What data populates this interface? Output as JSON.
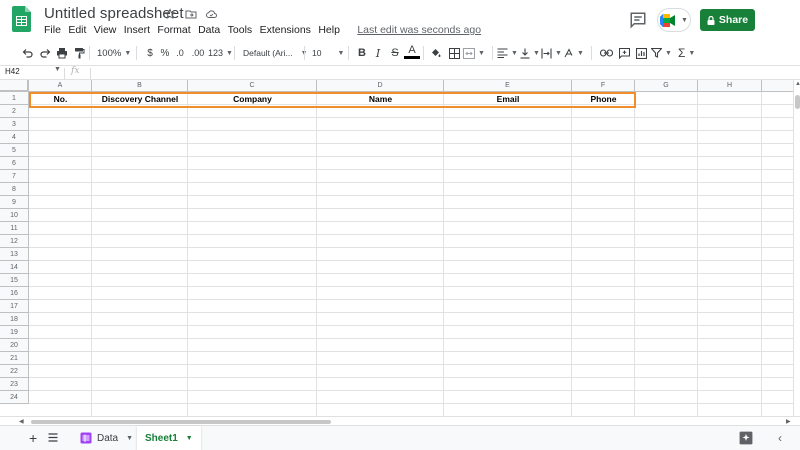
{
  "app": {
    "doc_title": "Untitled spreadsheet",
    "last_edit": "Last edit was seconds ago",
    "share_label": "Share"
  },
  "menu": [
    "File",
    "Edit",
    "View",
    "Insert",
    "Format",
    "Data",
    "Tools",
    "Extensions",
    "Help"
  ],
  "toolbar": {
    "zoom": "100%",
    "currency": "$",
    "percent": "%",
    "decrease_decimal": ".0",
    "increase_decimal": ".00",
    "more_formats": "123",
    "font": "Default (Ari...",
    "font_size": "10",
    "bold": "B",
    "italic": "I",
    "strikethrough": "S",
    "text_color": "A",
    "sum": "Σ"
  },
  "formula_bar": {
    "name_box": "H42",
    "fx": "fx"
  },
  "grid": {
    "columns": [
      "A",
      "B",
      "C",
      "D",
      "E",
      "F",
      "G",
      "H"
    ],
    "rows": [
      "1",
      "2",
      "3",
      "4",
      "5",
      "6",
      "7",
      "8",
      "9",
      "10",
      "11",
      "12",
      "13",
      "14",
      "15",
      "16",
      "17",
      "18",
      "19",
      "20",
      "21",
      "22",
      "23",
      "24"
    ],
    "row1": [
      "No.",
      "Discovery Channel",
      "Company",
      "Name",
      "Email",
      "Phone"
    ]
  },
  "sheets": {
    "tabs": [
      "Data",
      "Sheet1"
    ],
    "active": "Sheet1"
  },
  "colors": {
    "accent_green": "#188038",
    "highlight_orange": "#f28d2b",
    "data_tab_icon": "#a142f4"
  },
  "icons": {
    "star": "star-icon",
    "move": "folder-move-icon",
    "cloud": "cloud-status-icon",
    "comments": "comment-history-icon",
    "meet": "meet-icon",
    "lock": "lock-icon"
  }
}
